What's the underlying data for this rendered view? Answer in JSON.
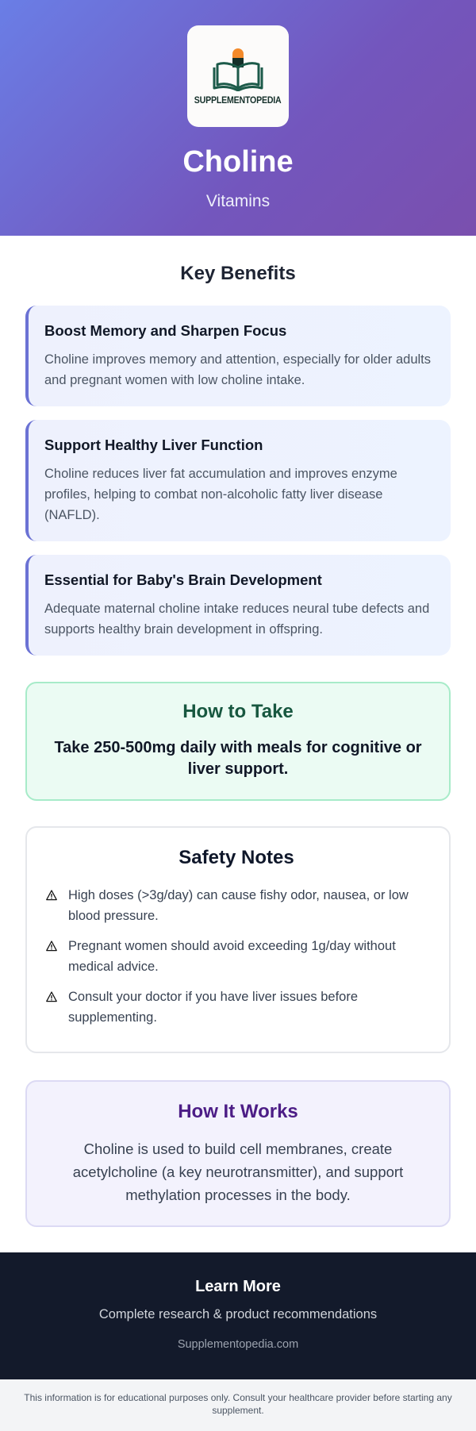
{
  "header": {
    "brand": "SUPPLEMENTOPEDIA",
    "title": "Choline",
    "category": "Vitamins"
  },
  "benefits": {
    "title": "Key Benefits",
    "items": [
      {
        "title": "Boost Memory and Sharpen Focus",
        "text": "Choline improves memory and attention, especially for older adults and pregnant women with low choline intake."
      },
      {
        "title": "Support Healthy Liver Function",
        "text": "Choline reduces liver fat accumulation and improves enzyme profiles, helping to combat non-alcoholic fatty liver disease (NAFLD)."
      },
      {
        "title": "Essential for Baby's Brain Development",
        "text": "Adequate maternal choline intake reduces neural tube defects and supports healthy brain development in offspring."
      }
    ]
  },
  "how_to_take": {
    "title": "How to Take",
    "text": "Take 250-500mg daily with meals for cognitive or liver support."
  },
  "safety": {
    "title": "Safety Notes",
    "icon": "warning-icon",
    "items": [
      "High doses (>3g/day) can cause fishy odor, nausea, or low blood pressure.",
      "Pregnant women should avoid exceeding 1g/day without medical advice.",
      "Consult your doctor if you have liver issues before supplementing."
    ]
  },
  "how_it_works": {
    "title": "How It Works",
    "text": "Choline is used to build cell membranes, create acetylcholine (a key neurotransmitter), and support methylation processes in the body."
  },
  "footer": {
    "title": "Learn More",
    "subtitle": "Complete research & product recommendations",
    "site": "Supplementopedia.com"
  },
  "disclaimer": "This information is for educational purposes only. Consult your healthcare provider before starting any supplement.",
  "colors": {
    "hero_start": "#6a7ee6",
    "hero_end": "#7a4fae",
    "benefit_accent": "#6b72d4",
    "howto_title": "#17573f",
    "works_title": "#4c1d86",
    "footer_bg": "#131a2b"
  }
}
